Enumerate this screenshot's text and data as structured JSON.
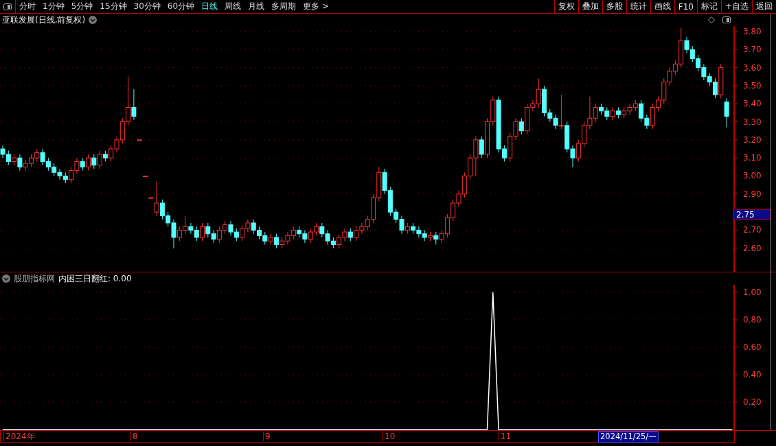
{
  "toolbar": {
    "periods": [
      {
        "label": "分时",
        "selected": false
      },
      {
        "label": "1分钟",
        "selected": false
      },
      {
        "label": "5分钟",
        "selected": false
      },
      {
        "label": "15分钟",
        "selected": false
      },
      {
        "label": "30分钟",
        "selected": false
      },
      {
        "label": "60分钟",
        "selected": false
      },
      {
        "label": "日线",
        "selected": true
      },
      {
        "label": "周线",
        "selected": false
      },
      {
        "label": "月线",
        "selected": false
      },
      {
        "label": "多周期",
        "selected": false
      },
      {
        "label": "更多 >",
        "selected": false
      }
    ],
    "buttons": [
      "复权",
      "叠加",
      "多股",
      "统计",
      "画线",
      "F10",
      "标记",
      "+自选",
      "返回"
    ]
  },
  "price_chart": {
    "title": "亚联发展(日线,前复权)",
    "chart_data": {
      "type": "candlestick",
      "grid": true,
      "ylim": [
        2.47,
        3.83
      ],
      "yticks": [
        {
          "value": 3.8,
          "label": "3.80"
        },
        {
          "value": 3.7,
          "label": "3.70"
        },
        {
          "value": 3.6,
          "label": "3.60"
        },
        {
          "value": 3.5,
          "label": "3.50"
        },
        {
          "value": 3.4,
          "label": "3.40"
        },
        {
          "value": 3.3,
          "label": "3.30"
        },
        {
          "value": 3.2,
          "label": "3.20"
        },
        {
          "value": 3.1,
          "label": "3.10"
        },
        {
          "value": 3.0,
          "label": "3.00"
        },
        {
          "value": 2.9,
          "label": "2.90"
        },
        {
          "value": 2.7,
          "label": "2.70"
        },
        {
          "value": 2.6,
          "label": "2.60"
        }
      ],
      "annotations": [
        "2.75"
      ],
      "ohlc": [
        [
          3.15,
          3.17,
          3.1,
          3.12
        ],
        [
          3.12,
          3.14,
          3.06,
          3.08
        ],
        [
          3.08,
          3.12,
          3.06,
          3.1
        ],
        [
          3.1,
          3.12,
          3.03,
          3.05
        ],
        [
          3.05,
          3.09,
          3.03,
          3.07
        ],
        [
          3.07,
          3.12,
          3.05,
          3.1
        ],
        [
          3.1,
          3.15,
          3.08,
          3.13
        ],
        [
          3.13,
          3.15,
          3.06,
          3.08
        ],
        [
          3.08,
          3.1,
          3.03,
          3.05
        ],
        [
          3.05,
          3.07,
          3.0,
          3.02
        ],
        [
          3.02,
          3.04,
          2.98,
          3.0
        ],
        [
          3.0,
          3.02,
          2.96,
          2.98
        ],
        [
          2.98,
          3.05,
          2.96,
          3.03
        ],
        [
          3.03,
          3.1,
          3.01,
          3.08
        ],
        [
          3.08,
          3.1,
          3.03,
          3.05
        ],
        [
          3.05,
          3.12,
          3.03,
          3.1
        ],
        [
          3.1,
          3.12,
          3.04,
          3.06
        ],
        [
          3.06,
          3.14,
          3.04,
          3.12
        ],
        [
          3.12,
          3.14,
          3.08,
          3.1
        ],
        [
          3.1,
          3.17,
          3.08,
          3.15
        ],
        [
          3.15,
          3.22,
          3.13,
          3.2
        ],
        [
          3.2,
          3.32,
          3.18,
          3.3
        ],
        [
          3.3,
          3.55,
          3.28,
          3.38
        ],
        [
          3.38,
          3.48,
          3.31,
          3.33
        ],
        [
          3.2,
          3.2,
          3.2,
          3.2
        ],
        [
          3.0,
          3.0,
          3.0,
          3.0
        ],
        [
          2.88,
          2.88,
          2.88,
          2.88
        ],
        [
          2.8,
          2.97,
          2.78,
          2.85
        ],
        [
          2.85,
          2.87,
          2.76,
          2.78
        ],
        [
          2.78,
          2.8,
          2.72,
          2.74
        ],
        [
          2.74,
          2.76,
          2.6,
          2.66
        ],
        [
          2.66,
          2.72,
          2.64,
          2.7
        ],
        [
          2.7,
          2.78,
          2.68,
          2.72
        ],
        [
          2.72,
          2.74,
          2.68,
          2.7
        ],
        [
          2.7,
          2.72,
          2.64,
          2.66
        ],
        [
          2.66,
          2.74,
          2.64,
          2.72
        ],
        [
          2.72,
          2.74,
          2.66,
          2.68
        ],
        [
          2.68,
          2.7,
          2.63,
          2.65
        ],
        [
          2.65,
          2.72,
          2.63,
          2.7
        ],
        [
          2.7,
          2.75,
          2.68,
          2.73
        ],
        [
          2.73,
          2.75,
          2.67,
          2.69
        ],
        [
          2.69,
          2.71,
          2.64,
          2.66
        ],
        [
          2.66,
          2.73,
          2.64,
          2.71
        ],
        [
          2.71,
          2.76,
          2.69,
          2.74
        ],
        [
          2.74,
          2.76,
          2.68,
          2.7
        ],
        [
          2.7,
          2.72,
          2.65,
          2.67
        ],
        [
          2.67,
          2.69,
          2.62,
          2.64
        ],
        [
          2.64,
          2.68,
          2.62,
          2.66
        ],
        [
          2.66,
          2.68,
          2.6,
          2.62
        ],
        [
          2.62,
          2.66,
          2.6,
          2.64
        ],
        [
          2.64,
          2.69,
          2.62,
          2.67
        ],
        [
          2.67,
          2.72,
          2.65,
          2.7
        ],
        [
          2.7,
          2.72,
          2.66,
          2.68
        ],
        [
          2.68,
          2.7,
          2.63,
          2.65
        ],
        [
          2.65,
          2.71,
          2.63,
          2.69
        ],
        [
          2.69,
          2.74,
          2.67,
          2.72
        ],
        [
          2.72,
          2.74,
          2.66,
          2.68
        ],
        [
          2.68,
          2.7,
          2.62,
          2.64
        ],
        [
          2.64,
          2.66,
          2.6,
          2.62
        ],
        [
          2.62,
          2.68,
          2.6,
          2.66
        ],
        [
          2.66,
          2.71,
          2.64,
          2.69
        ],
        [
          2.69,
          2.71,
          2.64,
          2.66
        ],
        [
          2.66,
          2.72,
          2.64,
          2.7
        ],
        [
          2.7,
          2.74,
          2.68,
          2.72
        ],
        [
          2.72,
          2.78,
          2.7,
          2.76
        ],
        [
          2.76,
          2.9,
          2.74,
          2.88
        ],
        [
          2.88,
          3.05,
          2.86,
          3.02
        ],
        [
          3.02,
          3.04,
          2.9,
          2.92
        ],
        [
          2.92,
          2.94,
          2.78,
          2.8
        ],
        [
          2.8,
          2.82,
          2.74,
          2.76
        ],
        [
          2.76,
          2.78,
          2.68,
          2.7
        ],
        [
          2.7,
          2.74,
          2.68,
          2.72
        ],
        [
          2.72,
          2.74,
          2.68,
          2.7
        ],
        [
          2.7,
          2.72,
          2.66,
          2.68
        ],
        [
          2.68,
          2.7,
          2.64,
          2.66
        ],
        [
          2.66,
          2.69,
          2.64,
          2.67
        ],
        [
          2.67,
          2.69,
          2.62,
          2.65
        ],
        [
          2.65,
          2.7,
          2.63,
          2.68
        ],
        [
          2.68,
          2.79,
          2.66,
          2.77
        ],
        [
          2.77,
          2.87,
          2.75,
          2.85
        ],
        [
          2.85,
          2.92,
          2.83,
          2.9
        ],
        [
          2.9,
          3.02,
          2.88,
          3.0
        ],
        [
          3.0,
          3.12,
          2.98,
          3.1
        ],
        [
          3.1,
          3.22,
          3.0,
          3.2
        ],
        [
          3.2,
          3.22,
          3.1,
          3.12
        ],
        [
          3.12,
          3.32,
          3.1,
          3.3
        ],
        [
          3.3,
          3.44,
          3.28,
          3.42
        ],
        [
          3.42,
          3.44,
          3.13,
          3.15
        ],
        [
          3.15,
          3.17,
          3.08,
          3.1
        ],
        [
          3.1,
          3.24,
          3.08,
          3.22
        ],
        [
          3.22,
          3.32,
          3.2,
          3.3
        ],
        [
          3.3,
          3.32,
          3.23,
          3.25
        ],
        [
          3.25,
          3.4,
          3.23,
          3.38
        ],
        [
          3.38,
          3.42,
          3.36,
          3.4
        ],
        [
          3.4,
          3.54,
          3.38,
          3.48
        ],
        [
          3.48,
          3.5,
          3.33,
          3.35
        ],
        [
          3.35,
          3.37,
          3.3,
          3.32
        ],
        [
          3.32,
          3.34,
          3.26,
          3.28
        ],
        [
          3.28,
          3.45,
          3.26,
          3.28
        ],
        [
          3.28,
          3.3,
          3.13,
          3.15
        ],
        [
          3.15,
          3.17,
          3.05,
          3.1
        ],
        [
          3.1,
          3.2,
          3.08,
          3.18
        ],
        [
          3.18,
          3.3,
          3.16,
          3.28
        ],
        [
          3.28,
          3.44,
          3.26,
          3.32
        ],
        [
          3.32,
          3.4,
          3.3,
          3.38
        ],
        [
          3.38,
          3.4,
          3.34,
          3.36
        ],
        [
          3.36,
          3.38,
          3.31,
          3.33
        ],
        [
          3.33,
          3.38,
          3.31,
          3.36
        ],
        [
          3.36,
          3.38,
          3.32,
          3.34
        ],
        [
          3.34,
          3.38,
          3.32,
          3.36
        ],
        [
          3.36,
          3.4,
          3.34,
          3.38
        ],
        [
          3.38,
          3.42,
          3.36,
          3.4
        ],
        [
          3.4,
          3.42,
          3.3,
          3.32
        ],
        [
          3.32,
          3.34,
          3.26,
          3.28
        ],
        [
          3.28,
          3.4,
          3.26,
          3.38
        ],
        [
          3.38,
          3.44,
          3.36,
          3.42
        ],
        [
          3.42,
          3.54,
          3.4,
          3.52
        ],
        [
          3.52,
          3.6,
          3.5,
          3.58
        ],
        [
          3.58,
          3.64,
          3.56,
          3.62
        ],
        [
          3.62,
          3.82,
          3.6,
          3.75
        ],
        [
          3.75,
          3.77,
          3.68,
          3.7
        ],
        [
          3.7,
          3.72,
          3.63,
          3.65
        ],
        [
          3.65,
          3.67,
          3.58,
          3.6
        ],
        [
          3.6,
          3.62,
          3.53,
          3.55
        ],
        [
          3.55,
          3.57,
          3.5,
          3.52
        ],
        [
          3.52,
          3.54,
          3.43,
          3.45
        ],
        [
          3.45,
          3.62,
          3.43,
          3.6
        ],
        [
          3.41,
          3.43,
          3.27,
          3.33
        ]
      ]
    }
  },
  "indicator": {
    "source": "股朋指标网",
    "label": "内困三日翻红: 0.00",
    "chart_data": {
      "type": "line",
      "grid": true,
      "series": [
        {
          "color": "#ffffff",
          "values": [
            0,
            0,
            0,
            0,
            0,
            0,
            0,
            0,
            0,
            0,
            0,
            0,
            0,
            0,
            0,
            0,
            0,
            0,
            0,
            0,
            0,
            0,
            0,
            0,
            0,
            0,
            0,
            0,
            0,
            0,
            0,
            0,
            0,
            0,
            0,
            0,
            0,
            0,
            0,
            0,
            0,
            0,
            0,
            0,
            0,
            0,
            0,
            0,
            0,
            0,
            0,
            0,
            0,
            0,
            0,
            0,
            0,
            0,
            0,
            0,
            0,
            0,
            0,
            0,
            0,
            0,
            0,
            0,
            0,
            0,
            0,
            0,
            0,
            0,
            0,
            0,
            0,
            0,
            0,
            0,
            0,
            0,
            0,
            0,
            0,
            0,
            1,
            0,
            0,
            0,
            0,
            0,
            0,
            0,
            0,
            0,
            0,
            0,
            0,
            0,
            0,
            0,
            0,
            0,
            0,
            0,
            0,
            0,
            0,
            0,
            0,
            0,
            0,
            0,
            0,
            0,
            0,
            0,
            0,
            0,
            0,
            0,
            0,
            0,
            0,
            0,
            0,
            0,
            0
          ]
        }
      ],
      "ylim": [
        0,
        1.05
      ],
      "yticks": [
        {
          "value": 0.2,
          "label": "0.20"
        },
        {
          "value": 0.4,
          "label": "0.40"
        },
        {
          "value": 0.6,
          "label": "0.60"
        },
        {
          "value": 0.8,
          "label": "0.80"
        },
        {
          "value": 1.0,
          "label": "1.00"
        }
      ]
    }
  },
  "date_axis": {
    "labels": [
      "2024年",
      "8",
      "9",
      "10",
      "11"
    ],
    "cursor_date": "2024/11/25/—"
  }
}
